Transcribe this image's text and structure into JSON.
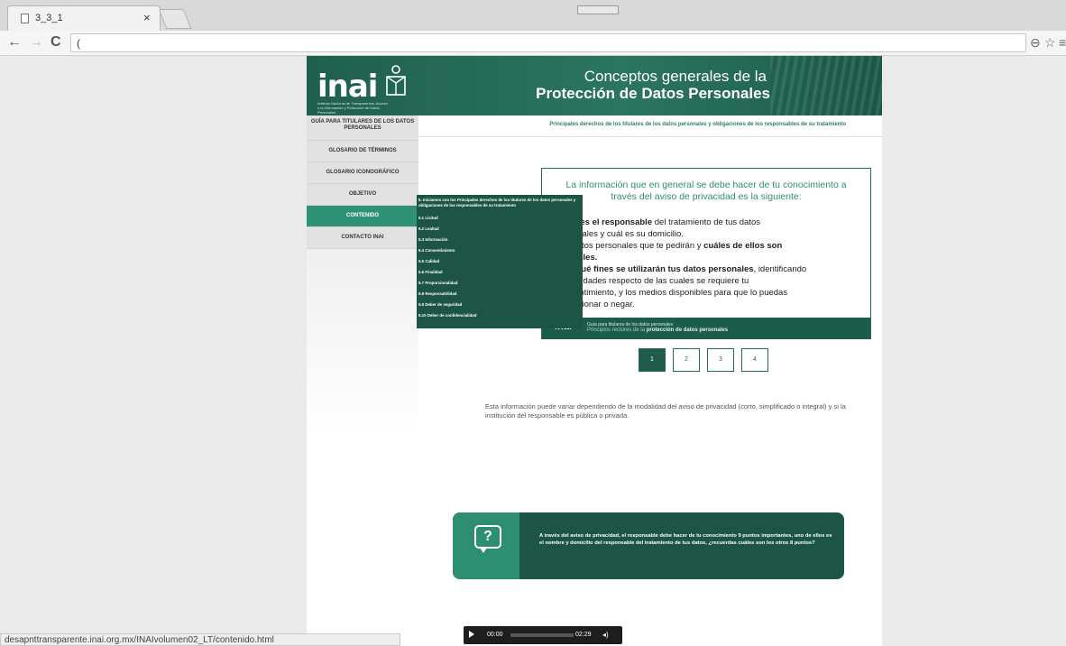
{
  "browser": {
    "tab_title": "3_3_1",
    "tab_close": "×",
    "back": "←",
    "forward": "→",
    "reload": "C",
    "url": "(",
    "zoom_icon": "⊖",
    "star_icon": "☆",
    "menu_icon": "≡"
  },
  "header": {
    "logo": "inai",
    "logo_small": "Instituto Nacional de Transparencia, Acceso a la Información y Protección de Datos Personales",
    "title_line1": "Conceptos generales de la",
    "title_line2": "Protección de Datos Personales"
  },
  "sidebar": {
    "items": [
      {
        "label": "GUÍA PARA TITULARES DE LOS DATOS PERSONALES"
      },
      {
        "label": "GLOSARIO DE TÉRMINOS"
      },
      {
        "label": "GLOSARIO ICONOGRÁFICO"
      },
      {
        "label": "OBJETIVO"
      },
      {
        "label": "CONTENIDO"
      },
      {
        "label": "CONTACTO INAI"
      }
    ]
  },
  "subtitle": "Principales derechos de los titulares de los datos personales y obligaciones de los responsables de su tratamiento",
  "dropdown": {
    "items": [
      "5. Iniciamos con los Principales derechos de los titulares de los datos personales y obligaciones de los responsables de su tratamiento",
      "5.1 Licitud",
      "5.2 Lealtad",
      "5.3 Información",
      "5.4 Consentimiento",
      "5.5 Calidad",
      "5.6 Finalidad",
      "5.7 Proporcionalidad",
      "5.8 Responsabilidad",
      "5.9 Deber de seguridad",
      "5.10 Deber de confidencialidad"
    ]
  },
  "slide": {
    "intro": "La información que en general se debe hacer de tu conocimiento a través del aviso de privacidad es la siguiente:",
    "p1_bold": "ién es el responsable",
    "p1_rest": " del tratamiento de tus datos",
    "p2": "rsonales y cuál es su domicilio.",
    "p3_a": "s datos personales que te pedirán y ",
    "p3_bold": "cuáles de ellos son",
    "p4_bold": "nsibles.",
    "p5_bold": "ra qué fines se utilizarán tus datos personales",
    "p5_rest": ", identificando",
    "p6": "finalidades respecto de las cuales se requiere tu",
    "p7": "nsentimiento, y los medios disponibles para que lo puedas",
    "p8": "porcionar o negar.",
    "footer_logo": "inai",
    "footer_line1": "Guía para titulares de los datos personales",
    "footer_line2_a": "Principios rectores de la ",
    "footer_line2_b": "protección de datos personales"
  },
  "pager": [
    "1",
    "2",
    "3",
    "4"
  ],
  "note": "Esta información puede variar dependiendo de la modalidad del aviso de privacidad (corto, simplificado o integral) y si la institución del responsable es pública o privada.",
  "question": {
    "icon": "?",
    "text": "A través del aviso de privacidad, el responsable debe hacer de tu conocimiento 9 puntos importantes, uno de ellos es el nombre y domicilio del responsable del tratamiento de tus datos, ¿recuerdas cuáles son los otros 8 puntos?"
  },
  "player": {
    "current": "00:00",
    "duration": "02:29",
    "volume_icon": "◂)"
  },
  "status_url": "desapnttransparente.inai.org.mx/INAIvolumen02_LT/contenido.html",
  "colors": {
    "brand_dark": "#1c5545",
    "brand_accent": "#2f9276"
  }
}
